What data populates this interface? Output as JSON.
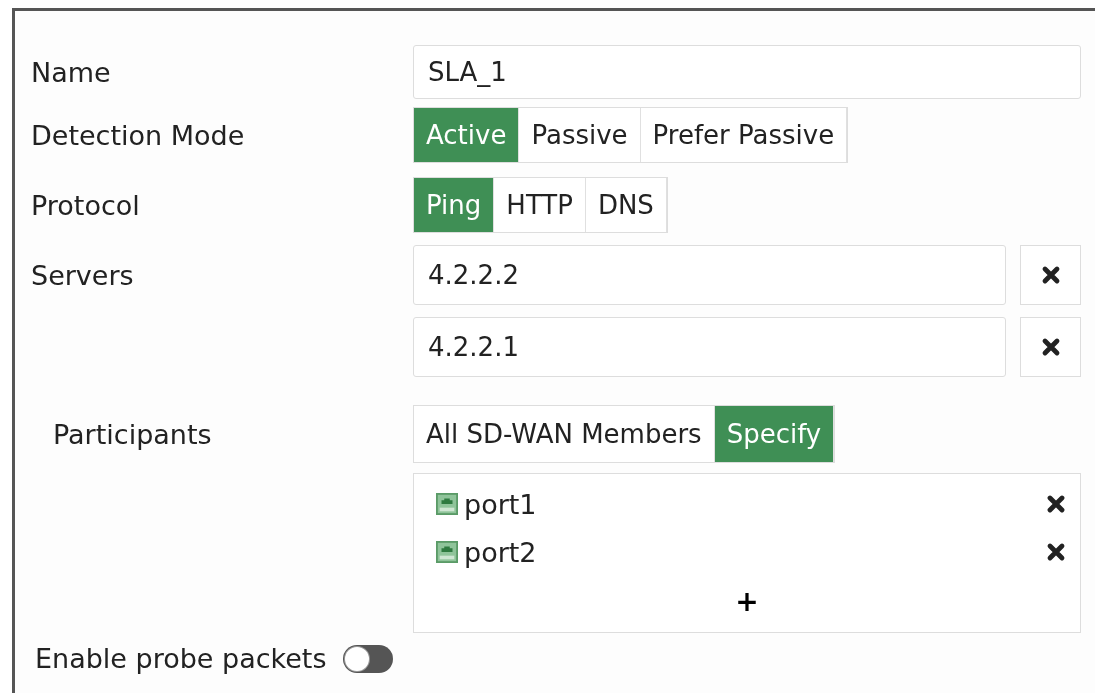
{
  "name": {
    "label": "Name",
    "value": "SLA_1"
  },
  "detection_mode": {
    "label": "Detection Mode",
    "options": [
      {
        "label": "Active",
        "selected": true
      },
      {
        "label": "Passive",
        "selected": false
      },
      {
        "label": "Prefer Passive",
        "selected": false
      }
    ]
  },
  "protocol": {
    "label": "Protocol",
    "options": [
      {
        "label": "Ping",
        "selected": true
      },
      {
        "label": "HTTP",
        "selected": false
      },
      {
        "label": "DNS",
        "selected": false
      }
    ]
  },
  "servers": {
    "label": "Servers",
    "values": [
      "4.2.2.2",
      "4.2.2.1"
    ]
  },
  "participants": {
    "label": "Participants",
    "options": [
      {
        "label": "All SD-WAN Members",
        "selected": false
      },
      {
        "label": "Specify",
        "selected": true
      }
    ],
    "members": [
      "port1",
      "port2"
    ],
    "add": "+"
  },
  "probe_packets": {
    "label": "Enable probe packets",
    "on": false
  }
}
